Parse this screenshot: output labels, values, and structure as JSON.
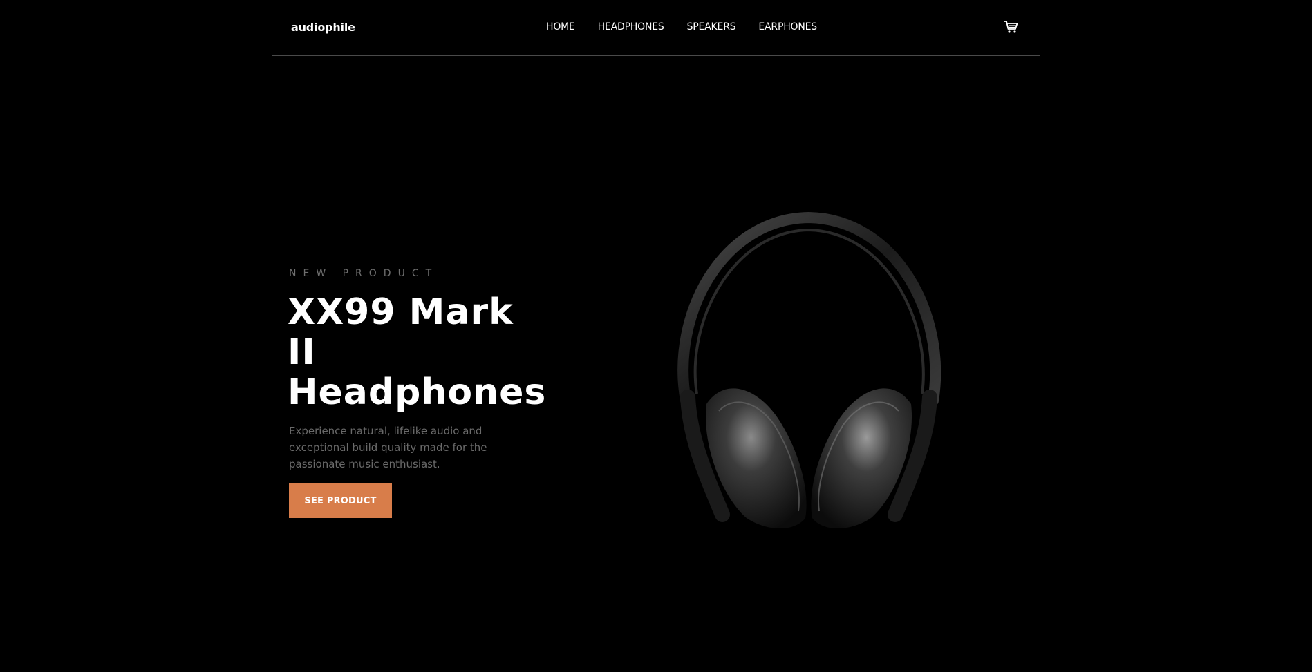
{
  "header": {
    "logo": "audiophile",
    "nav": [
      {
        "label": "HOME"
      },
      {
        "label": "HEADPHONES"
      },
      {
        "label": "SPEAKERS"
      },
      {
        "label": "EARPHONES"
      }
    ],
    "cart_icon": "cart-icon"
  },
  "hero": {
    "eyebrow": "NEW PRODUCT",
    "title": "XX99 Mark II Headphones",
    "description": "Experience natural, lifelike audio and exceptional build quality made for the passionate music enthusiast.",
    "cta_label": "SEE PRODUCT",
    "image_icon": "headphones-image"
  },
  "colors": {
    "background": "#000000",
    "accent": "#d87d4a",
    "muted_text": "#6a6a6a",
    "divider": "#4a4a4a"
  }
}
